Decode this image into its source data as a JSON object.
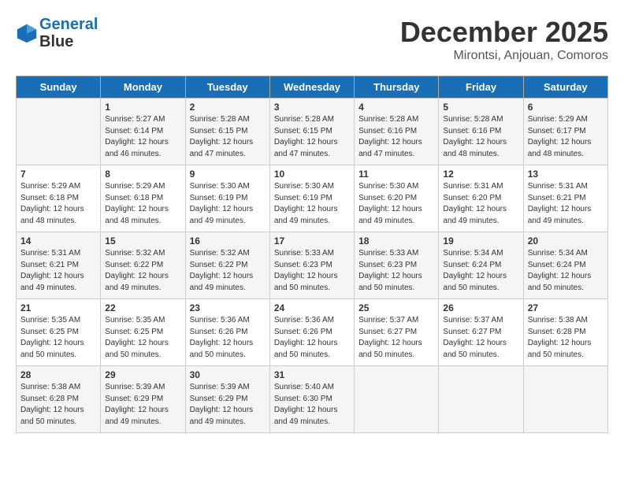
{
  "header": {
    "logo_line1": "General",
    "logo_line2": "Blue",
    "month_title": "December 2025",
    "location": "Mirontsi, Anjouan, Comoros"
  },
  "days_of_week": [
    "Sunday",
    "Monday",
    "Tuesday",
    "Wednesday",
    "Thursday",
    "Friday",
    "Saturday"
  ],
  "weeks": [
    [
      {
        "day": "",
        "info": ""
      },
      {
        "day": "1",
        "info": "Sunrise: 5:27 AM\nSunset: 6:14 PM\nDaylight: 12 hours\nand 46 minutes."
      },
      {
        "day": "2",
        "info": "Sunrise: 5:28 AM\nSunset: 6:15 PM\nDaylight: 12 hours\nand 47 minutes."
      },
      {
        "day": "3",
        "info": "Sunrise: 5:28 AM\nSunset: 6:15 PM\nDaylight: 12 hours\nand 47 minutes."
      },
      {
        "day": "4",
        "info": "Sunrise: 5:28 AM\nSunset: 6:16 PM\nDaylight: 12 hours\nand 47 minutes."
      },
      {
        "day": "5",
        "info": "Sunrise: 5:28 AM\nSunset: 6:16 PM\nDaylight: 12 hours\nand 48 minutes."
      },
      {
        "day": "6",
        "info": "Sunrise: 5:29 AM\nSunset: 6:17 PM\nDaylight: 12 hours\nand 48 minutes."
      }
    ],
    [
      {
        "day": "7",
        "info": "Sunrise: 5:29 AM\nSunset: 6:18 PM\nDaylight: 12 hours\nand 48 minutes."
      },
      {
        "day": "8",
        "info": "Sunrise: 5:29 AM\nSunset: 6:18 PM\nDaylight: 12 hours\nand 48 minutes."
      },
      {
        "day": "9",
        "info": "Sunrise: 5:30 AM\nSunset: 6:19 PM\nDaylight: 12 hours\nand 49 minutes."
      },
      {
        "day": "10",
        "info": "Sunrise: 5:30 AM\nSunset: 6:19 PM\nDaylight: 12 hours\nand 49 minutes."
      },
      {
        "day": "11",
        "info": "Sunrise: 5:30 AM\nSunset: 6:20 PM\nDaylight: 12 hours\nand 49 minutes."
      },
      {
        "day": "12",
        "info": "Sunrise: 5:31 AM\nSunset: 6:20 PM\nDaylight: 12 hours\nand 49 minutes."
      },
      {
        "day": "13",
        "info": "Sunrise: 5:31 AM\nSunset: 6:21 PM\nDaylight: 12 hours\nand 49 minutes."
      }
    ],
    [
      {
        "day": "14",
        "info": "Sunrise: 5:31 AM\nSunset: 6:21 PM\nDaylight: 12 hours\nand 49 minutes."
      },
      {
        "day": "15",
        "info": "Sunrise: 5:32 AM\nSunset: 6:22 PM\nDaylight: 12 hours\nand 49 minutes."
      },
      {
        "day": "16",
        "info": "Sunrise: 5:32 AM\nSunset: 6:22 PM\nDaylight: 12 hours\nand 49 minutes."
      },
      {
        "day": "17",
        "info": "Sunrise: 5:33 AM\nSunset: 6:23 PM\nDaylight: 12 hours\nand 50 minutes."
      },
      {
        "day": "18",
        "info": "Sunrise: 5:33 AM\nSunset: 6:23 PM\nDaylight: 12 hours\nand 50 minutes."
      },
      {
        "day": "19",
        "info": "Sunrise: 5:34 AM\nSunset: 6:24 PM\nDaylight: 12 hours\nand 50 minutes."
      },
      {
        "day": "20",
        "info": "Sunrise: 5:34 AM\nSunset: 6:24 PM\nDaylight: 12 hours\nand 50 minutes."
      }
    ],
    [
      {
        "day": "21",
        "info": "Sunrise: 5:35 AM\nSunset: 6:25 PM\nDaylight: 12 hours\nand 50 minutes."
      },
      {
        "day": "22",
        "info": "Sunrise: 5:35 AM\nSunset: 6:25 PM\nDaylight: 12 hours\nand 50 minutes."
      },
      {
        "day": "23",
        "info": "Sunrise: 5:36 AM\nSunset: 6:26 PM\nDaylight: 12 hours\nand 50 minutes."
      },
      {
        "day": "24",
        "info": "Sunrise: 5:36 AM\nSunset: 6:26 PM\nDaylight: 12 hours\nand 50 minutes."
      },
      {
        "day": "25",
        "info": "Sunrise: 5:37 AM\nSunset: 6:27 PM\nDaylight: 12 hours\nand 50 minutes."
      },
      {
        "day": "26",
        "info": "Sunrise: 5:37 AM\nSunset: 6:27 PM\nDaylight: 12 hours\nand 50 minutes."
      },
      {
        "day": "27",
        "info": "Sunrise: 5:38 AM\nSunset: 6:28 PM\nDaylight: 12 hours\nand 50 minutes."
      }
    ],
    [
      {
        "day": "28",
        "info": "Sunrise: 5:38 AM\nSunset: 6:28 PM\nDaylight: 12 hours\nand 50 minutes."
      },
      {
        "day": "29",
        "info": "Sunrise: 5:39 AM\nSunset: 6:29 PM\nDaylight: 12 hours\nand 49 minutes."
      },
      {
        "day": "30",
        "info": "Sunrise: 5:39 AM\nSunset: 6:29 PM\nDaylight: 12 hours\nand 49 minutes."
      },
      {
        "day": "31",
        "info": "Sunrise: 5:40 AM\nSunset: 6:30 PM\nDaylight: 12 hours\nand 49 minutes."
      },
      {
        "day": "",
        "info": ""
      },
      {
        "day": "",
        "info": ""
      },
      {
        "day": "",
        "info": ""
      }
    ]
  ]
}
